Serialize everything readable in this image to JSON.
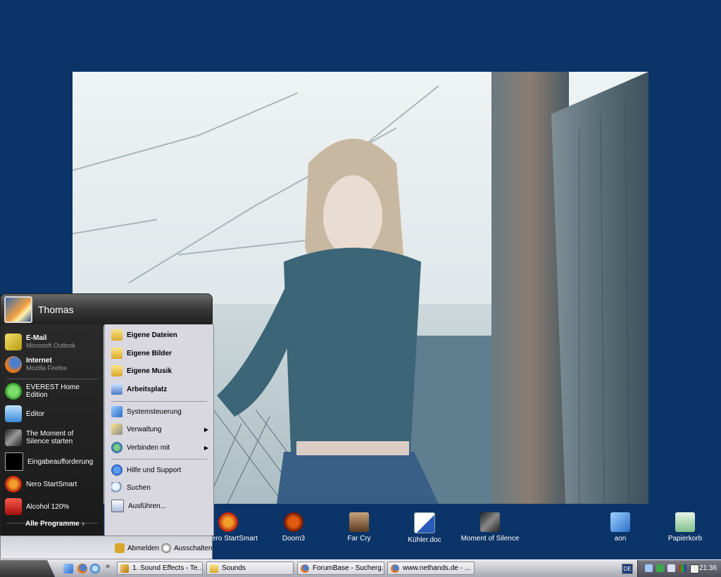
{
  "start_menu": {
    "user_name": "Thomas",
    "pinned": [
      {
        "title": "E-Mail",
        "subtitle": "Microsoft Outlook"
      },
      {
        "title": "Internet",
        "subtitle": "Mozilla Firefox"
      }
    ],
    "recent": [
      {
        "label": "EVEREST Home Edition"
      },
      {
        "label": "Editor"
      },
      {
        "label": "The Moment of Silence starten"
      },
      {
        "label": "Eingabeaufforderung"
      },
      {
        "label": "Nero StartSmart"
      },
      {
        "label": "Alcohol 120%"
      }
    ],
    "all_programs": "Alle Programme",
    "places": [
      {
        "label": "Eigene Dateien"
      },
      {
        "label": "Eigene Bilder"
      },
      {
        "label": "Eigene Musik"
      },
      {
        "label": "Arbeitsplatz"
      }
    ],
    "system": [
      {
        "label": "Systemsteuerung"
      },
      {
        "label": "Verwaltung"
      },
      {
        "label": "Verbinden mit"
      }
    ],
    "help": [
      {
        "label": "Hilfe und Support"
      },
      {
        "label": "Suchen"
      },
      {
        "label": "Ausführen..."
      }
    ],
    "logoff": "Abmelden",
    "shutdown": "Ausschalten"
  },
  "desktop_icons": [
    {
      "label": "Nero StartSmart"
    },
    {
      "label": "Doom3"
    },
    {
      "label": "Far Cry"
    },
    {
      "label": "Kühler.doc"
    },
    {
      "label": "Moment of Silence"
    },
    {
      "label": "aon"
    },
    {
      "label": "Papierkorb"
    }
  ],
  "taskbar": {
    "tasks": [
      {
        "label": "1. Sound Effects - Te..."
      },
      {
        "label": "Sounds"
      },
      {
        "label": "ForumBase - Sucherg..."
      },
      {
        "label": "www.nethands.de - ..."
      }
    ],
    "language": "DE",
    "clock": "21:36"
  },
  "colors": {
    "desktop_bg": "#0b3468",
    "menu_dark": "#1f1f1f",
    "menu_light": "#d9d7df"
  }
}
